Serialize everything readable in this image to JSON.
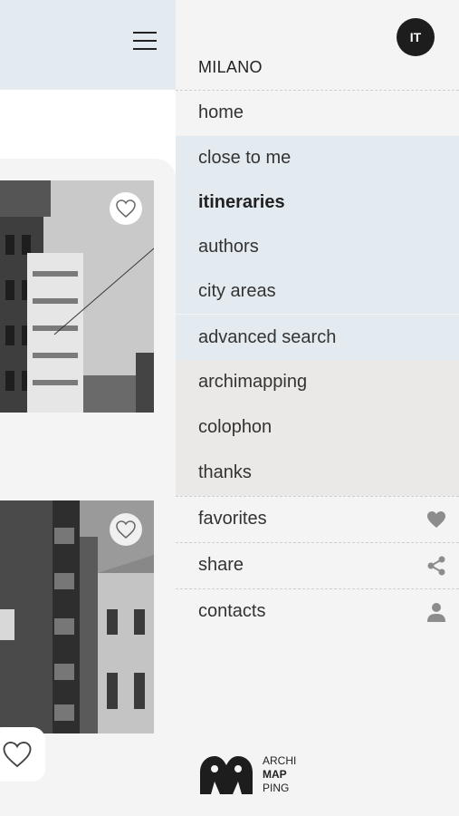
{
  "header": {
    "menu_icon": "hamburger-icon"
  },
  "cards": [
    {
      "favorite_icon": "heart-outline-icon"
    },
    {
      "favorite_icon": "heart-outline-icon"
    }
  ],
  "menu": {
    "language": "IT",
    "city": "MILANO",
    "items": [
      {
        "label": "home"
      },
      {
        "label": "close to me"
      },
      {
        "label": "itineraries"
      },
      {
        "label": "authors"
      },
      {
        "label": "city areas"
      },
      {
        "label": "advanced search"
      },
      {
        "label": "archimapping"
      },
      {
        "label": "colophon"
      },
      {
        "label": "thanks"
      },
      {
        "label": "favorites",
        "icon": "heart-icon"
      },
      {
        "label": "share",
        "icon": "share-icon"
      },
      {
        "label": "contacts",
        "icon": "user-icon"
      }
    ],
    "logo": {
      "line1": "ARCHI",
      "line2": "MAP",
      "line3": "PING"
    }
  },
  "colors": {
    "header_bg": "#e4ebf0",
    "section_blue": "#e4ebf0",
    "section_grey": "#ebe9e7",
    "menu_bg": "#f4f4f4",
    "badge_bg": "#1d1d1d"
  }
}
